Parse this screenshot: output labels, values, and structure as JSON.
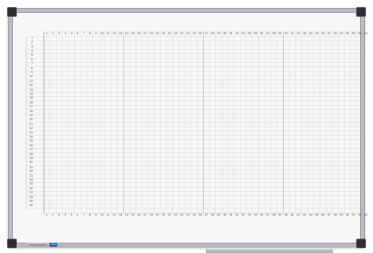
{
  "board": {
    "brand": "Legamaster",
    "brand_badge": "PRO"
  },
  "planner": {
    "column_headers": [
      "1",
      "2",
      "3",
      "4",
      "5",
      "6",
      "7",
      "8",
      "9",
      "10",
      "11",
      "12",
      "13",
      "14",
      "15",
      "16",
      "17",
      "18",
      "19",
      "20",
      "21",
      "22",
      "23",
      "24",
      "25",
      "26",
      "27",
      "28",
      "29",
      "30",
      "31",
      "32",
      "33",
      "34",
      "35",
      "36",
      "37",
      "38",
      "39",
      "40",
      "41",
      "42",
      "43",
      "44",
      "45",
      "46",
      "47",
      "48",
      "49",
      "50",
      "51",
      "52",
      "53"
    ],
    "row_numbers": [
      "1",
      "2",
      "3",
      "4",
      "5",
      "6",
      "7",
      "8",
      "9",
      "10",
      "11",
      "12",
      "13",
      "14",
      "15",
      "16",
      "17",
      "18",
      "19",
      "20",
      "21",
      "22",
      "23",
      "24",
      "25",
      "26",
      "27",
      "28",
      "29",
      "30",
      "31",
      "32",
      "33",
      "34",
      "35",
      "36",
      "37",
      "38",
      "39",
      "40"
    ],
    "section_break_every_columns": 13
  },
  "colors": {
    "frame": "#b9bcc0",
    "corner": "#2b2d30",
    "surface": "#f7f7f7",
    "grid": "#c9c9c9",
    "grid_strong": "#9b9b9b"
  }
}
